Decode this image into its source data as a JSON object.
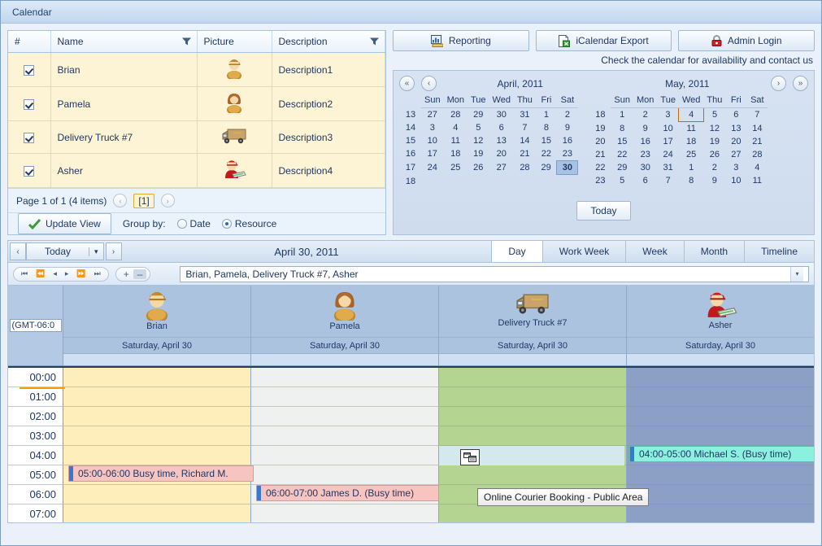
{
  "window": {
    "title": "Calendar"
  },
  "resource_grid": {
    "columns": [
      {
        "label": "#",
        "filter": false
      },
      {
        "label": "Name",
        "filter": true
      },
      {
        "label": "Picture",
        "filter": false
      },
      {
        "label": "Description",
        "filter": true
      }
    ],
    "rows": [
      {
        "checked": true,
        "name": "Brian",
        "picture": "person-male-icon",
        "description": "Description1"
      },
      {
        "checked": true,
        "name": "Pamela",
        "picture": "person-female-icon",
        "description": "Description2"
      },
      {
        "checked": true,
        "name": "Delivery Truck #7",
        "picture": "truck-icon",
        "description": "Description3"
      },
      {
        "checked": true,
        "name": "Asher",
        "picture": "courier-icon",
        "description": "Description4"
      }
    ],
    "pager": {
      "status": "Page 1 of 1 (4 items)",
      "prev": "‹",
      "current": "[1]",
      "next": "›"
    },
    "actions": {
      "update_view": "Update View",
      "group_by_label": "Group by:",
      "group_options": [
        {
          "label": "Date",
          "selected": false
        },
        {
          "label": "Resource",
          "selected": true
        }
      ]
    }
  },
  "top_buttons": [
    {
      "label": "Reporting",
      "icon": "report-chart-icon"
    },
    {
      "label": "iCalendar Export",
      "icon": "export-document-icon"
    },
    {
      "label": "Admin Login",
      "icon": "lock-icon"
    }
  ],
  "tagline": "Check the calendar for availability and contact us",
  "month_picker": {
    "nav": {
      "first": "«",
      "prev": "‹",
      "next": "›",
      "last": "»"
    },
    "today_button": "Today",
    "weekday_headers": [
      "Sun",
      "Mon",
      "Tue",
      "Wed",
      "Thu",
      "Fri",
      "Sat"
    ],
    "months": [
      {
        "title": "April, 2011",
        "weeks": [
          {
            "num": "13",
            "days": [
              {
                "d": "27",
                "out": true
              },
              {
                "d": "28",
                "out": true
              },
              {
                "d": "29",
                "out": true
              },
              {
                "d": "30",
                "out": true
              },
              {
                "d": "31",
                "out": true
              },
              {
                "d": "1"
              },
              {
                "d": "2",
                "sun": true
              }
            ]
          },
          {
            "num": "14",
            "days": [
              {
                "d": "3",
                "sun": true
              },
              {
                "d": "4"
              },
              {
                "d": "5"
              },
              {
                "d": "6"
              },
              {
                "d": "7"
              },
              {
                "d": "8"
              },
              {
                "d": "9",
                "sun": true
              }
            ]
          },
          {
            "num": "15",
            "days": [
              {
                "d": "10",
                "sun": true
              },
              {
                "d": "11"
              },
              {
                "d": "12"
              },
              {
                "d": "13"
              },
              {
                "d": "14"
              },
              {
                "d": "15"
              },
              {
                "d": "16",
                "sun": true
              }
            ]
          },
          {
            "num": "16",
            "days": [
              {
                "d": "17",
                "sun": true
              },
              {
                "d": "18"
              },
              {
                "d": "19"
              },
              {
                "d": "20"
              },
              {
                "d": "21"
              },
              {
                "d": "22"
              },
              {
                "d": "23",
                "sun": true
              }
            ]
          },
          {
            "num": "17",
            "days": [
              {
                "d": "24",
                "sun": true
              },
              {
                "d": "25"
              },
              {
                "d": "26"
              },
              {
                "d": "27"
              },
              {
                "d": "28"
              },
              {
                "d": "29"
              },
              {
                "d": "30",
                "sel": true
              }
            ]
          },
          {
            "num": "18",
            "days": [
              {
                "d": ""
              },
              {
                "d": ""
              },
              {
                "d": ""
              },
              {
                "d": ""
              },
              {
                "d": ""
              },
              {
                "d": ""
              },
              {
                "d": ""
              }
            ]
          }
        ]
      },
      {
        "title": "May, 2011",
        "weeks": [
          {
            "num": "18",
            "days": [
              {
                "d": "1",
                "sun": true
              },
              {
                "d": "2"
              },
              {
                "d": "3"
              },
              {
                "d": "4",
                "today": true
              },
              {
                "d": "5"
              },
              {
                "d": "6"
              },
              {
                "d": "7",
                "sun": true
              }
            ]
          },
          {
            "num": "19",
            "days": [
              {
                "d": "8",
                "sun": true
              },
              {
                "d": "9"
              },
              {
                "d": "10"
              },
              {
                "d": "11"
              },
              {
                "d": "12"
              },
              {
                "d": "13"
              },
              {
                "d": "14",
                "sun": true
              }
            ]
          },
          {
            "num": "20",
            "days": [
              {
                "d": "15",
                "sun": true
              },
              {
                "d": "16"
              },
              {
                "d": "17"
              },
              {
                "d": "18"
              },
              {
                "d": "19"
              },
              {
                "d": "20"
              },
              {
                "d": "21",
                "sun": true
              }
            ]
          },
          {
            "num": "21",
            "days": [
              {
                "d": "22",
                "sun": true
              },
              {
                "d": "23"
              },
              {
                "d": "24"
              },
              {
                "d": "25"
              },
              {
                "d": "26"
              },
              {
                "d": "27"
              },
              {
                "d": "28",
                "sun": true
              }
            ]
          },
          {
            "num": "22",
            "days": [
              {
                "d": "29",
                "sun": true
              },
              {
                "d": "30"
              },
              {
                "d": "31"
              },
              {
                "d": "1",
                "out": true
              },
              {
                "d": "2",
                "out": true
              },
              {
                "d": "3",
                "out": true
              },
              {
                "d": "4",
                "out": true
              }
            ]
          },
          {
            "num": "23",
            "days": [
              {
                "d": "5",
                "out": true
              },
              {
                "d": "6",
                "out": true
              },
              {
                "d": "7",
                "out": true
              },
              {
                "d": "8",
                "out": true
              },
              {
                "d": "9",
                "out": true
              },
              {
                "d": "10",
                "out": true
              },
              {
                "d": "11",
                "out": true
              }
            ]
          }
        ]
      }
    ]
  },
  "scheduler": {
    "today_button": "Today",
    "prev_arrow": "‹",
    "next_arrow": "›",
    "dropdown_arrow": "▾",
    "date_title": "April 30, 2011",
    "view_tabs": [
      {
        "label": "Day",
        "active": true
      },
      {
        "label": "Work Week",
        "active": false
      },
      {
        "label": "Week",
        "active": false
      },
      {
        "label": "Month",
        "active": false
      },
      {
        "label": "Timeline",
        "active": false
      }
    ],
    "nav_pill": [
      "⏮",
      "⏪",
      "◂",
      "▸",
      "⏩",
      "⏭"
    ],
    "zoom_pill": {
      "plus": "+",
      "minus": "–"
    },
    "resource_selector_value": "Brian, Pamela, Delivery Truck #7, Asher",
    "timezone_label": "(GMT-06:0",
    "resources": [
      {
        "name": "Brian",
        "date": "Saturday, April 30",
        "icon": "person-male-icon",
        "color": "#fdeebb"
      },
      {
        "name": "Pamela",
        "date": "Saturday, April 30",
        "icon": "person-female-icon",
        "color": "#eff0f0"
      },
      {
        "name": "Delivery Truck #7",
        "date": "Saturday, April 30",
        "icon": "truck-icon",
        "color": "#b4d492"
      },
      {
        "name": "Asher",
        "date": "Saturday, April 30",
        "icon": "courier-icon",
        "color": "#8ba0c4"
      }
    ],
    "time_slots": [
      "00:00",
      "01:00",
      "02:00",
      "03:00",
      "04:00",
      "05:00",
      "06:00",
      "07:00"
    ],
    "events": [
      {
        "text": "05:00-06:00 Busy time, Richard M.",
        "resource": 0,
        "start": "05:00",
        "end": "06:00",
        "style": "busy"
      },
      {
        "text": "06:00-07:00 James D. (Busy time)",
        "resource": 1,
        "start": "06:00",
        "end": "07:00",
        "style": "busy"
      },
      {
        "text": "04:00-05:00 Michael S. (Busy time)",
        "resource": 3,
        "start": "04:00",
        "end": "05:00",
        "style": "teal"
      }
    ],
    "tooltip": "Online Courier Booking - Public Area"
  }
}
